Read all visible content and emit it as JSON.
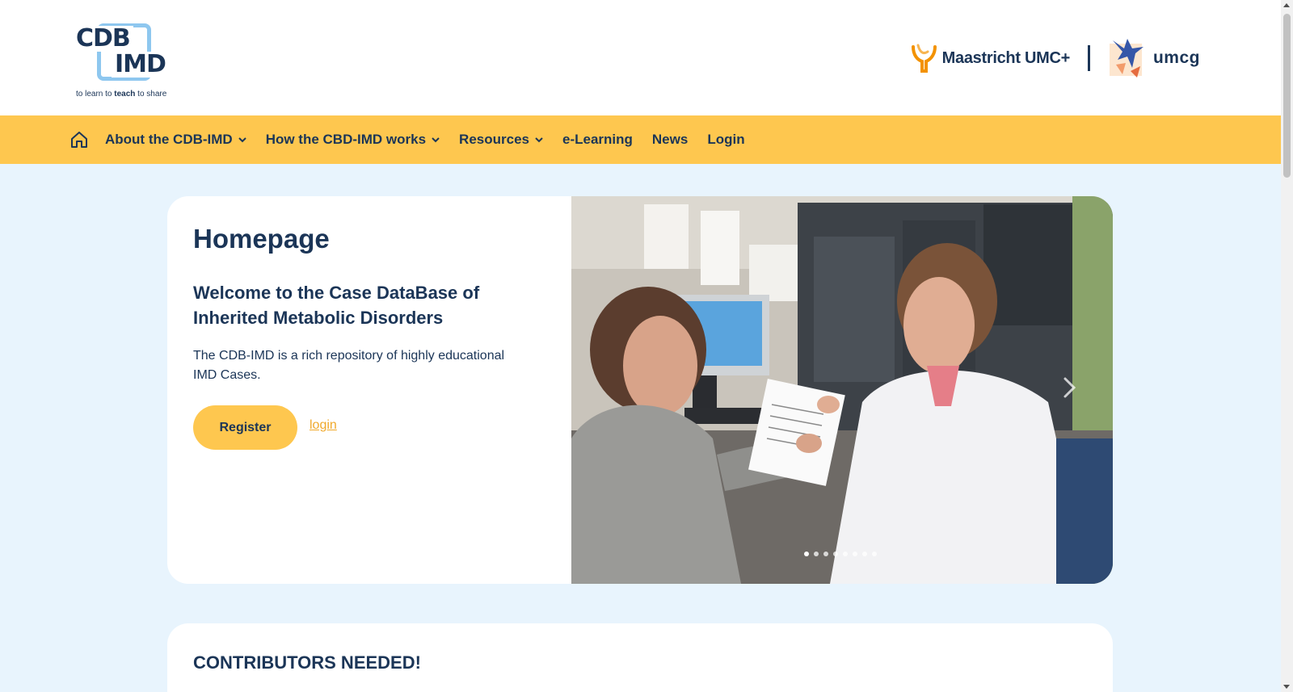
{
  "logo": {
    "line1": "CDB",
    "line2": "IMD",
    "tagline_a": "to learn to ",
    "tagline_b": "teach",
    "tagline_c": " to share"
  },
  "partners": {
    "mumc_label": "Maastricht UMC+",
    "umcg_label": "umcg"
  },
  "nav": {
    "home_icon": "home-icon",
    "items": [
      {
        "label": "About the CDB-IMD",
        "has_dropdown": true
      },
      {
        "label": "How the CBD-IMD works",
        "has_dropdown": true
      },
      {
        "label": "Resources",
        "has_dropdown": true
      },
      {
        "label": "e-Learning",
        "has_dropdown": false
      },
      {
        "label": "News",
        "has_dropdown": false
      },
      {
        "label": "Login",
        "has_dropdown": false
      }
    ]
  },
  "hero": {
    "title": "Homepage",
    "subtitle": "Welcome to the Case DataBase of Inherited Metabolic Disorders",
    "text": "The CDB-IMD is a rich repository of highly educational IMD Cases.",
    "register_label": "Register",
    "login_link": "login",
    "carousel_slide_count": 8,
    "carousel_active_index": 0
  },
  "contributors": {
    "title": "CONTRIBUTORS NEEDED!"
  },
  "colors": {
    "brand_yellow": "#fec74f",
    "navy": "#1b3557",
    "page_bg": "#e8f4fd",
    "logo_blue": "#8ec7ef",
    "link_orange": "#f0a92b"
  }
}
